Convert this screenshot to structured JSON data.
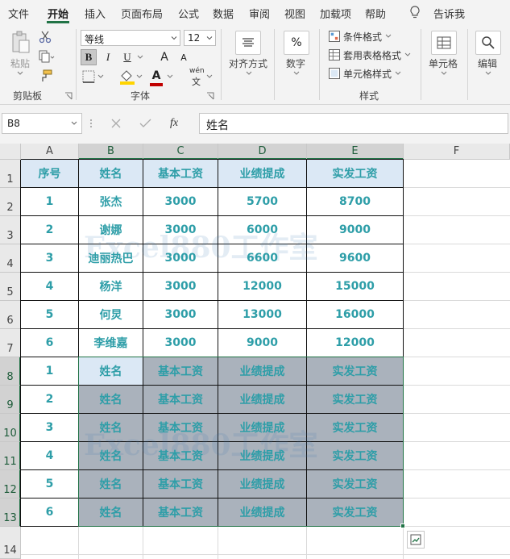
{
  "menu": {
    "items": [
      "文件",
      "开始",
      "插入",
      "页面布局",
      "公式",
      "数据",
      "审阅",
      "视图",
      "加载项",
      "帮助"
    ],
    "tell_me": "告诉我"
  },
  "ribbon": {
    "clipboard": {
      "paste": "粘贴",
      "group": "剪贴板"
    },
    "font": {
      "name": "等线",
      "size": "12",
      "bold": "B",
      "italic": "I",
      "underline": "U",
      "grow": "A",
      "shrink": "A",
      "color_letter": "A",
      "phonetic_top": "wén",
      "phonetic_bottom": "文",
      "group": "字体"
    },
    "alignment": {
      "label": "对齐方式"
    },
    "number": {
      "label": "数字",
      "symbol": "%"
    },
    "styles": {
      "conditional": "条件格式",
      "table": "套用表格格式",
      "cell_styles": "单元格样式",
      "group": "样式"
    },
    "cells": {
      "label": "单元格"
    },
    "editing": {
      "label": "编辑"
    }
  },
  "formula_bar": {
    "name_box": "B8",
    "fx": "fx",
    "value": "姓名"
  },
  "columns": [
    "A",
    "B",
    "C",
    "D",
    "E",
    "F"
  ],
  "rows": [
    "1",
    "2",
    "3",
    "4",
    "5",
    "6",
    "7",
    "8",
    "9",
    "10",
    "11",
    "12",
    "13",
    "14"
  ],
  "table": [
    [
      "序号",
      "姓名",
      "基本工资",
      "业绩提成",
      "实发工资"
    ],
    [
      "1",
      "张杰",
      "3000",
      "5700",
      "8700"
    ],
    [
      "2",
      "谢娜",
      "3000",
      "6000",
      "9000"
    ],
    [
      "3",
      "迪丽热巴",
      "3000",
      "6600",
      "9600"
    ],
    [
      "4",
      "杨洋",
      "3000",
      "12000",
      "15000"
    ],
    [
      "5",
      "何炅",
      "3000",
      "13000",
      "16000"
    ],
    [
      "6",
      "李维嘉",
      "3000",
      "9000",
      "12000"
    ],
    [
      "1",
      "姓名",
      "基本工资",
      "业绩提成",
      "实发工资"
    ],
    [
      "2",
      "姓名",
      "基本工资",
      "业绩提成",
      "实发工资"
    ],
    [
      "3",
      "姓名",
      "基本工资",
      "业绩提成",
      "实发工资"
    ],
    [
      "4",
      "姓名",
      "基本工资",
      "业绩提成",
      "实发工资"
    ],
    [
      "5",
      "姓名",
      "基本工资",
      "业绩提成",
      "实发工资"
    ],
    [
      "6",
      "姓名",
      "基本工资",
      "业绩提成",
      "实发工资"
    ]
  ],
  "watermark": "Excel880工作室",
  "colors": {
    "accent": "#217346",
    "text": "#2e9ea8",
    "header_fill": "#dbe8f5",
    "selection_fill": "#aab2bc"
  }
}
